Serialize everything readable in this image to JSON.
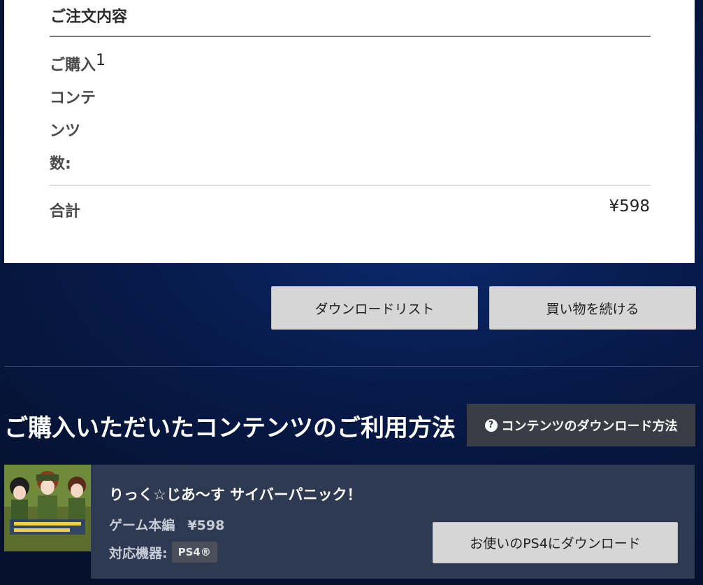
{
  "order": {
    "title": "ご注文内容",
    "qty_label": "ご購入コンテンツ数:",
    "qty_value": "1",
    "total_label": "合計",
    "total_value": "¥598"
  },
  "actions": {
    "download_list": "ダウンロードリスト",
    "continue_shopping": "買い物を続ける"
  },
  "usage": {
    "title": "ご購入いただいたコンテンツのご利用方法",
    "help_label": "コンテンツのダウンロード方法",
    "help_icon": "question-circle-icon"
  },
  "product": {
    "name": "りっく☆じあ～す サイバーパニック！",
    "type": "ゲーム本編",
    "price": "¥598",
    "platform_label": "対応機器:",
    "platform": "PS4®",
    "download_button": "お使いのPS4にダウンロード"
  },
  "colors": {
    "background": "#071a4a",
    "panel": "#2e3a52",
    "help_button": "#3a3d45",
    "button": "#d6d6d6"
  }
}
